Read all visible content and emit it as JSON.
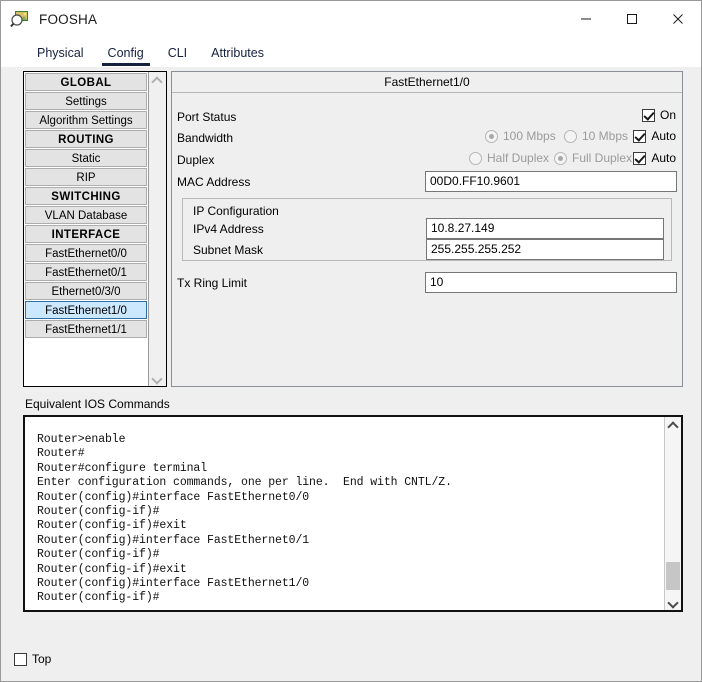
{
  "window": {
    "title": "FOOSHA",
    "icon": "app-magnifier-icon",
    "minimize_label": "—",
    "maximize_label": "□",
    "close_label": "✕"
  },
  "tabs": [
    {
      "label": "Physical",
      "active": false
    },
    {
      "label": "Config",
      "active": true
    },
    {
      "label": "CLI",
      "active": false
    },
    {
      "label": "Attributes",
      "active": false
    }
  ],
  "sidebar": {
    "items": [
      {
        "label": "GLOBAL",
        "type": "header"
      },
      {
        "label": "Settings",
        "type": "item"
      },
      {
        "label": "Algorithm Settings",
        "type": "item"
      },
      {
        "label": "ROUTING",
        "type": "header"
      },
      {
        "label": "Static",
        "type": "item"
      },
      {
        "label": "RIP",
        "type": "item"
      },
      {
        "label": "SWITCHING",
        "type": "header"
      },
      {
        "label": "VLAN Database",
        "type": "item"
      },
      {
        "label": "INTERFACE",
        "type": "header"
      },
      {
        "label": "FastEthernet0/0",
        "type": "item"
      },
      {
        "label": "FastEthernet0/1",
        "type": "item"
      },
      {
        "label": "Ethernet0/3/0",
        "type": "item"
      },
      {
        "label": "FastEthernet1/0",
        "type": "item",
        "selected": true
      },
      {
        "label": "FastEthernet1/1",
        "type": "item"
      }
    ],
    "selected_color": "#cce8ff"
  },
  "panel": {
    "title": "FastEthernet1/0",
    "port_status": {
      "label": "Port Status",
      "on_label": "On",
      "checked": true
    },
    "bandwidth": {
      "label": "Bandwidth",
      "option_100": "100 Mbps",
      "option_10": "10 Mbps",
      "selected": "100 Mbps",
      "auto_label": "Auto",
      "auto_checked": true
    },
    "duplex": {
      "label": "Duplex",
      "option_half": "Half Duplex",
      "option_full": "Full Duplex",
      "selected": "Full Duplex",
      "auto_label": "Auto",
      "auto_checked": true
    },
    "mac": {
      "label": "MAC Address",
      "value": "00D0.FF10.9601"
    },
    "ip_configuration": {
      "legend": "IP Configuration",
      "ipv4_label": "IPv4 Address",
      "ipv4_value": "10.8.27.149",
      "mask_label": "Subnet Mask",
      "mask_value": "255.255.255.252"
    },
    "tx_ring_limit": {
      "label": "Tx Ring Limit",
      "value": "10"
    }
  },
  "ios": {
    "label": "Equivalent IOS Commands",
    "text": "Router>enable\nRouter#\nRouter#configure terminal\nEnter configuration commands, one per line.  End with CNTL/Z.\nRouter(config)#interface FastEthernet0/0\nRouter(config-if)#\nRouter(config-if)#exit\nRouter(config)#interface FastEthernet0/1\nRouter(config-if)#\nRouter(config-if)#exit\nRouter(config)#interface FastEthernet1/0\nRouter(config-if)#"
  },
  "footer": {
    "top_label": "Top",
    "top_checked": false
  }
}
